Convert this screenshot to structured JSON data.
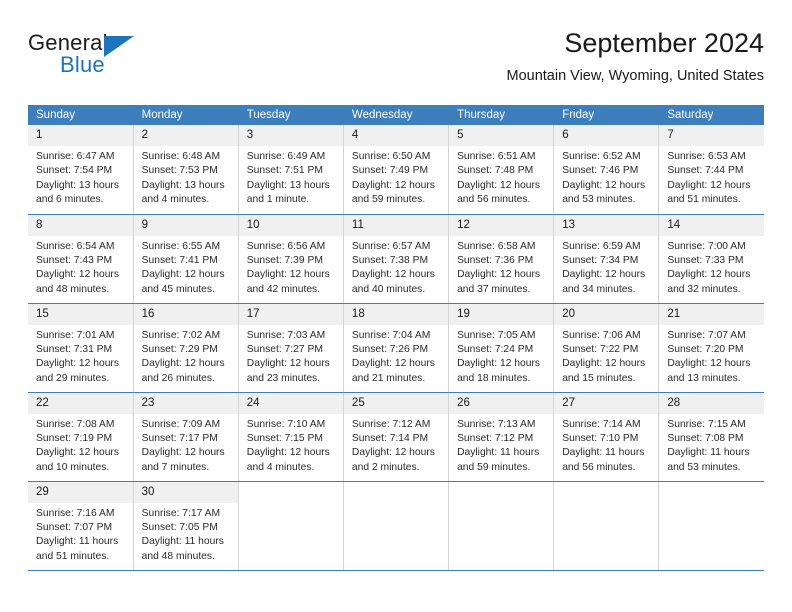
{
  "brand": {
    "name_top": "General",
    "name_bottom": "Blue",
    "triangle_icon": "blue-triangle-logo-mark",
    "color_primary": "#1e74bb",
    "color_text": "#1c1c1c"
  },
  "header": {
    "title": "September 2024",
    "subtitle": "Mountain View, Wyoming, United States"
  },
  "calendar": {
    "header_bg": "#3d7ebd",
    "daynum_bg": "#f0f0f0",
    "weekday_headers": [
      "Sunday",
      "Monday",
      "Tuesday",
      "Wednesday",
      "Thursday",
      "Friday",
      "Saturday"
    ],
    "weeks": [
      [
        {
          "day": "1",
          "sunrise": "Sunrise: 6:47 AM",
          "sunset": "Sunset: 7:54 PM",
          "daylight": "Daylight: 13 hours and 6 minutes."
        },
        {
          "day": "2",
          "sunrise": "Sunrise: 6:48 AM",
          "sunset": "Sunset: 7:53 PM",
          "daylight": "Daylight: 13 hours and 4 minutes."
        },
        {
          "day": "3",
          "sunrise": "Sunrise: 6:49 AM",
          "sunset": "Sunset: 7:51 PM",
          "daylight": "Daylight: 13 hours and 1 minute."
        },
        {
          "day": "4",
          "sunrise": "Sunrise: 6:50 AM",
          "sunset": "Sunset: 7:49 PM",
          "daylight": "Daylight: 12 hours and 59 minutes."
        },
        {
          "day": "5",
          "sunrise": "Sunrise: 6:51 AM",
          "sunset": "Sunset: 7:48 PM",
          "daylight": "Daylight: 12 hours and 56 minutes."
        },
        {
          "day": "6",
          "sunrise": "Sunrise: 6:52 AM",
          "sunset": "Sunset: 7:46 PM",
          "daylight": "Daylight: 12 hours and 53 minutes."
        },
        {
          "day": "7",
          "sunrise": "Sunrise: 6:53 AM",
          "sunset": "Sunset: 7:44 PM",
          "daylight": "Daylight: 12 hours and 51 minutes."
        }
      ],
      [
        {
          "day": "8",
          "sunrise": "Sunrise: 6:54 AM",
          "sunset": "Sunset: 7:43 PM",
          "daylight": "Daylight: 12 hours and 48 minutes."
        },
        {
          "day": "9",
          "sunrise": "Sunrise: 6:55 AM",
          "sunset": "Sunset: 7:41 PM",
          "daylight": "Daylight: 12 hours and 45 minutes."
        },
        {
          "day": "10",
          "sunrise": "Sunrise: 6:56 AM",
          "sunset": "Sunset: 7:39 PM",
          "daylight": "Daylight: 12 hours and 42 minutes."
        },
        {
          "day": "11",
          "sunrise": "Sunrise: 6:57 AM",
          "sunset": "Sunset: 7:38 PM",
          "daylight": "Daylight: 12 hours and 40 minutes."
        },
        {
          "day": "12",
          "sunrise": "Sunrise: 6:58 AM",
          "sunset": "Sunset: 7:36 PM",
          "daylight": "Daylight: 12 hours and 37 minutes."
        },
        {
          "day": "13",
          "sunrise": "Sunrise: 6:59 AM",
          "sunset": "Sunset: 7:34 PM",
          "daylight": "Daylight: 12 hours and 34 minutes."
        },
        {
          "day": "14",
          "sunrise": "Sunrise: 7:00 AM",
          "sunset": "Sunset: 7:33 PM",
          "daylight": "Daylight: 12 hours and 32 minutes."
        }
      ],
      [
        {
          "day": "15",
          "sunrise": "Sunrise: 7:01 AM",
          "sunset": "Sunset: 7:31 PM",
          "daylight": "Daylight: 12 hours and 29 minutes."
        },
        {
          "day": "16",
          "sunrise": "Sunrise: 7:02 AM",
          "sunset": "Sunset: 7:29 PM",
          "daylight": "Daylight: 12 hours and 26 minutes."
        },
        {
          "day": "17",
          "sunrise": "Sunrise: 7:03 AM",
          "sunset": "Sunset: 7:27 PM",
          "daylight": "Daylight: 12 hours and 23 minutes."
        },
        {
          "day": "18",
          "sunrise": "Sunrise: 7:04 AM",
          "sunset": "Sunset: 7:26 PM",
          "daylight": "Daylight: 12 hours and 21 minutes."
        },
        {
          "day": "19",
          "sunrise": "Sunrise: 7:05 AM",
          "sunset": "Sunset: 7:24 PM",
          "daylight": "Daylight: 12 hours and 18 minutes."
        },
        {
          "day": "20",
          "sunrise": "Sunrise: 7:06 AM",
          "sunset": "Sunset: 7:22 PM",
          "daylight": "Daylight: 12 hours and 15 minutes."
        },
        {
          "day": "21",
          "sunrise": "Sunrise: 7:07 AM",
          "sunset": "Sunset: 7:20 PM",
          "daylight": "Daylight: 12 hours and 13 minutes."
        }
      ],
      [
        {
          "day": "22",
          "sunrise": "Sunrise: 7:08 AM",
          "sunset": "Sunset: 7:19 PM",
          "daylight": "Daylight: 12 hours and 10 minutes."
        },
        {
          "day": "23",
          "sunrise": "Sunrise: 7:09 AM",
          "sunset": "Sunset: 7:17 PM",
          "daylight": "Daylight: 12 hours and 7 minutes."
        },
        {
          "day": "24",
          "sunrise": "Sunrise: 7:10 AM",
          "sunset": "Sunset: 7:15 PM",
          "daylight": "Daylight: 12 hours and 4 minutes."
        },
        {
          "day": "25",
          "sunrise": "Sunrise: 7:12 AM",
          "sunset": "Sunset: 7:14 PM",
          "daylight": "Daylight: 12 hours and 2 minutes."
        },
        {
          "day": "26",
          "sunrise": "Sunrise: 7:13 AM",
          "sunset": "Sunset: 7:12 PM",
          "daylight": "Daylight: 11 hours and 59 minutes."
        },
        {
          "day": "27",
          "sunrise": "Sunrise: 7:14 AM",
          "sunset": "Sunset: 7:10 PM",
          "daylight": "Daylight: 11 hours and 56 minutes."
        },
        {
          "day": "28",
          "sunrise": "Sunrise: 7:15 AM",
          "sunset": "Sunset: 7:08 PM",
          "daylight": "Daylight: 11 hours and 53 minutes."
        }
      ],
      [
        {
          "day": "29",
          "sunrise": "Sunrise: 7:16 AM",
          "sunset": "Sunset: 7:07 PM",
          "daylight": "Daylight: 11 hours and 51 minutes."
        },
        {
          "day": "30",
          "sunrise": "Sunrise: 7:17 AM",
          "sunset": "Sunset: 7:05 PM",
          "daylight": "Daylight: 11 hours and 48 minutes."
        },
        {
          "day": "",
          "sunrise": "",
          "sunset": "",
          "daylight": ""
        },
        {
          "day": "",
          "sunrise": "",
          "sunset": "",
          "daylight": ""
        },
        {
          "day": "",
          "sunrise": "",
          "sunset": "",
          "daylight": ""
        },
        {
          "day": "",
          "sunrise": "",
          "sunset": "",
          "daylight": ""
        },
        {
          "day": "",
          "sunrise": "",
          "sunset": "",
          "daylight": ""
        }
      ]
    ]
  }
}
